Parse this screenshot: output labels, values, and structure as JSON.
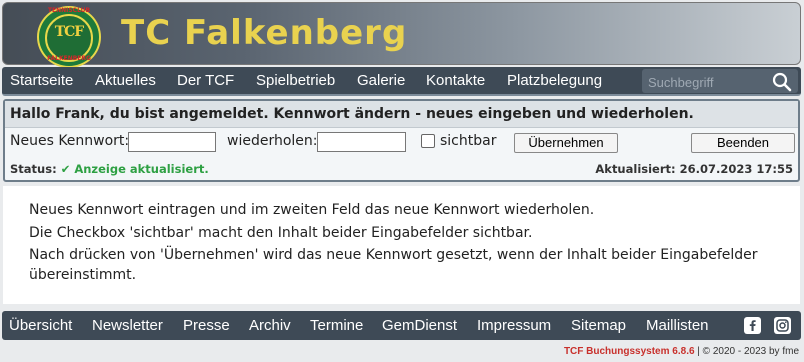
{
  "header": {
    "logo_top": "TENNISCLUB",
    "logo_mono": "TCF",
    "logo_bottom": "FALKENBERG",
    "title": "TC Falkenberg"
  },
  "nav": {
    "items": [
      "Startseite",
      "Aktuelles",
      "Der TCF",
      "Spielbetrieb",
      "Galerie",
      "Kontakte",
      "Platzbelegung"
    ],
    "search_placeholder": "Suchbegriff"
  },
  "panel": {
    "greeting": "Hallo Frank, du bist angemeldet. Kennwort ändern - neues eingeben und wiederholen.",
    "new_password_label": "Neues Kennwort:",
    "repeat_label": "wiederholen:",
    "visible_label": "sichtbar",
    "apply_button": "Übernehmen",
    "logout_button": "Beenden",
    "status_label": "Status:",
    "status_text": "✔ Anzeige aktualisiert.",
    "updated_text": "Aktualisiert: 26.07.2023 17:55"
  },
  "content": {
    "lines": [
      "Neues Kennwort eintragen und im zweiten Feld das neue Kennwort wiederholen.",
      "Die Checkbox 'sichtbar' macht den Inhalt beider Eingabefelder sichtbar.",
      "Nach drücken von 'Übernehmen' wird das neue Kennwort gesetzt, wenn der Inhalt beider Eingabefelder übereinstimmt."
    ]
  },
  "footer": {
    "items": [
      "Übersicht",
      "Newsletter",
      "Presse",
      "Archiv",
      "Termine",
      "GemDienst",
      "Impressum",
      "Sitemap",
      "Maillisten"
    ],
    "copyright_brand": "TCF Buchungssystem 6.8.6",
    "copyright_rest": " | © 2020 - 2023 by fme"
  },
  "colors": {
    "title": "#e9d24f",
    "nav_bg": "#3e4a56",
    "status_ok": "#2ea043",
    "brand_red": "#c8302c"
  }
}
